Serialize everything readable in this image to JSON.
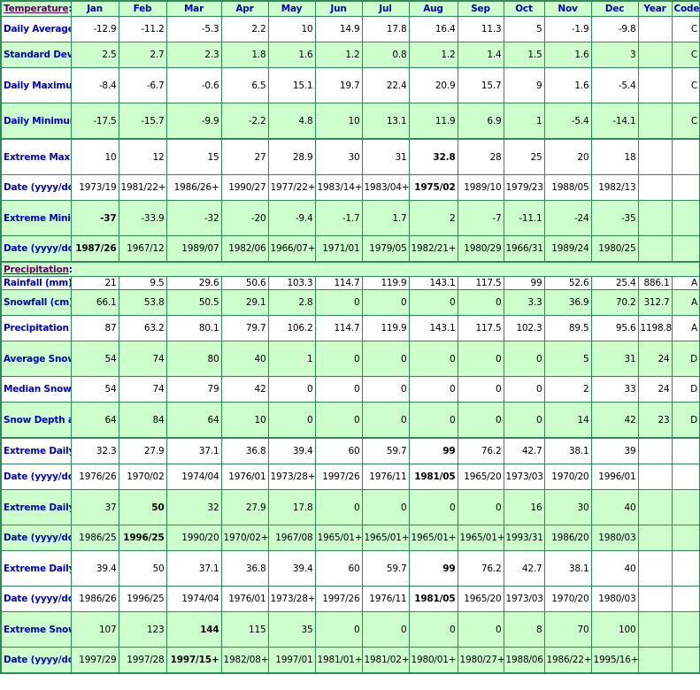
{
  "header": {
    "section_label": "Temperature",
    "months": [
      "Jan",
      "Feb",
      "Mar",
      "Apr",
      "May",
      "Jun",
      "Jul",
      "Aug",
      "Sep",
      "Oct",
      "Nov",
      "Dec"
    ],
    "year_label": "Year",
    "code_label": "Code"
  },
  "colors": {
    "border": "#2e8b57",
    "row_green": "#ccffcc",
    "row_white": "#ffffff",
    "label_blue": "#0000cc",
    "section_link": "#660066"
  },
  "temperature": [
    {
      "label": "Daily Average (°C)",
      "values": [
        "-12.9",
        "-11.2",
        "-5.3",
        "2.2",
        "10",
        "14.9",
        "17.8",
        "16.4",
        "11.3",
        "5",
        "-1.9",
        "-9.8"
      ],
      "year": "",
      "code": "C",
      "bold": []
    },
    {
      "label": "Standard Deviation",
      "values": [
        "2.5",
        "2.7",
        "2.3",
        "1.8",
        "1.6",
        "1.2",
        "0.8",
        "1.2",
        "1.4",
        "1.5",
        "1.6",
        "3"
      ],
      "year": "",
      "code": "C",
      "bold": []
    },
    {
      "label": "Daily Maximum (°C)",
      "values": [
        "-8.4",
        "-6.7",
        "-0.6",
        "6.5",
        "15.1",
        "19.7",
        "22.4",
        "20.9",
        "15.7",
        "9",
        "1.6",
        "-5.4"
      ],
      "year": "",
      "code": "C",
      "bold": []
    },
    {
      "label": "Daily Minimum (°C)",
      "values": [
        "-17.5",
        "-15.7",
        "-9.9",
        "-2.2",
        "4.8",
        "10",
        "13.1",
        "11.9",
        "6.9",
        "1",
        "-5.4",
        "-14.1"
      ],
      "year": "",
      "code": "C",
      "bold": []
    },
    {
      "label": "Extreme Maximum (°C)",
      "values": [
        "10",
        "12",
        "15",
        "27",
        "28.9",
        "30",
        "31",
        "32.8",
        "28",
        "25",
        "20",
        "18"
      ],
      "year": "",
      "code": "",
      "bold": [
        7
      ]
    },
    {
      "label": "Date (yyyy/dd)",
      "values": [
        "1973/19",
        "1981/22+",
        "1986/26+",
        "1990/27",
        "1977/22+",
        "1983/14+",
        "1983/04+",
        "1975/02",
        "1989/10",
        "1979/23",
        "1988/05",
        "1982/13"
      ],
      "year": "",
      "code": "",
      "bold": [
        7
      ]
    },
    {
      "label": "Extreme Minimum (°C)",
      "values": [
        "-37",
        "-33.9",
        "-32",
        "-20",
        "-9.4",
        "-1.7",
        "1.7",
        "2",
        "-7",
        "-11.1",
        "-24",
        "-35"
      ],
      "year": "",
      "code": "",
      "bold": [
        0
      ]
    },
    {
      "label": "Date (yyyy/dd)",
      "values": [
        "1987/26",
        "1967/12",
        "1989/07",
        "1982/06",
        "1966/07+",
        "1971/01",
        "1979/05",
        "1982/21+",
        "1980/29",
        "1966/31",
        "1989/24",
        "1980/25"
      ],
      "year": "",
      "code": "",
      "bold": [
        0
      ]
    }
  ],
  "precipitation_section_label": "Precipitation",
  "precipitation": [
    {
      "label": "Rainfall (mm)",
      "values": [
        "21",
        "9.5",
        "29.6",
        "50.6",
        "103.3",
        "114.7",
        "119.9",
        "143.1",
        "117.5",
        "99",
        "52.6",
        "25.4"
      ],
      "year": "886.1",
      "code": "A",
      "bold": []
    },
    {
      "label": "Snowfall (cm)",
      "values": [
        "66.1",
        "53.8",
        "50.5",
        "29.1",
        "2.8",
        "0",
        "0",
        "0",
        "0",
        "3.3",
        "36.9",
        "70.2"
      ],
      "year": "312.7",
      "code": "A",
      "bold": []
    },
    {
      "label": "Precipitation (mm)",
      "values": [
        "87",
        "63.2",
        "80.1",
        "79.7",
        "106.2",
        "114.7",
        "119.9",
        "143.1",
        "117.5",
        "102.3",
        "89.5",
        "95.6"
      ],
      "year": "1198.8",
      "code": "A",
      "bold": []
    },
    {
      "label": "Average Snow Depth (cm)",
      "values": [
        "54",
        "74",
        "80",
        "40",
        "1",
        "0",
        "0",
        "0",
        "0",
        "0",
        "5",
        "31"
      ],
      "year": "24",
      "code": "D",
      "bold": []
    },
    {
      "label": "Median Snow Depth (cm)",
      "values": [
        "54",
        "74",
        "79",
        "42",
        "0",
        "0",
        "0",
        "0",
        "0",
        "0",
        "2",
        "33"
      ],
      "year": "24",
      "code": "D",
      "bold": []
    },
    {
      "label": "Snow Depth at Month-end (cm)",
      "values": [
        "64",
        "84",
        "64",
        "10",
        "0",
        "0",
        "0",
        "0",
        "0",
        "0",
        "14",
        "42"
      ],
      "year": "23",
      "code": "D",
      "bold": []
    },
    {
      "label": "Extreme Daily Rainfall (mm)",
      "values": [
        "32.3",
        "27.9",
        "37.1",
        "36.8",
        "39.4",
        "60",
        "59.7",
        "99",
        "76.2",
        "42.7",
        "38.1",
        "39"
      ],
      "year": "",
      "code": "",
      "bold": [
        7
      ]
    },
    {
      "label": "Date (yyyy/dd)",
      "values": [
        "1976/26",
        "1970/02",
        "1974/04",
        "1976/01",
        "1973/28+",
        "1997/26",
        "1976/11",
        "1981/05",
        "1965/20",
        "1973/03",
        "1970/20",
        "1996/01"
      ],
      "year": "",
      "code": "",
      "bold": [
        7
      ]
    },
    {
      "label": "Extreme Daily Snowfall (cm)",
      "values": [
        "37",
        "50",
        "32",
        "27.9",
        "17.8",
        "0",
        "0",
        "0",
        "0",
        "16",
        "30",
        "40"
      ],
      "year": "",
      "code": "",
      "bold": [
        1
      ]
    },
    {
      "label": "Date (yyyy/dd)",
      "values": [
        "1986/25",
        "1996/25",
        "1990/20",
        "1970/02+",
        "1967/08",
        "1965/01+",
        "1965/01+",
        "1965/01+",
        "1965/01+",
        "1993/31",
        "1986/20",
        "1980/03"
      ],
      "year": "",
      "code": "",
      "bold": [
        1
      ]
    },
    {
      "label": "Extreme Daily Precipitation (mm)",
      "values": [
        "39.4",
        "50",
        "37.1",
        "36.8",
        "39.4",
        "60",
        "59.7",
        "99",
        "76.2",
        "42.7",
        "38.1",
        "40"
      ],
      "year": "",
      "code": "",
      "bold": [
        7
      ]
    },
    {
      "label": "Date (yyyy/dd)",
      "values": [
        "1986/26",
        "1996/25",
        "1974/04",
        "1976/01",
        "1973/28+",
        "1997/26",
        "1976/11",
        "1981/05",
        "1965/20",
        "1973/03",
        "1970/20",
        "1980/03"
      ],
      "year": "",
      "code": "",
      "bold": [
        7
      ]
    },
    {
      "label": "Extreme Snow Depth (cm)",
      "values": [
        "107",
        "123",
        "144",
        "115",
        "35",
        "0",
        "0",
        "0",
        "0",
        "8",
        "70",
        "100"
      ],
      "year": "",
      "code": "",
      "bold": [
        2
      ]
    },
    {
      "label": "Date (yyyy/dd)",
      "values": [
        "1997/29",
        "1997/28",
        "1997/15+",
        "1982/08+",
        "1997/01",
        "1981/01+",
        "1981/02+",
        "1980/01+",
        "1980/27+",
        "1988/06",
        "1986/22+",
        "1995/16+"
      ],
      "year": "",
      "code": "",
      "bold": [
        2
      ]
    }
  ]
}
